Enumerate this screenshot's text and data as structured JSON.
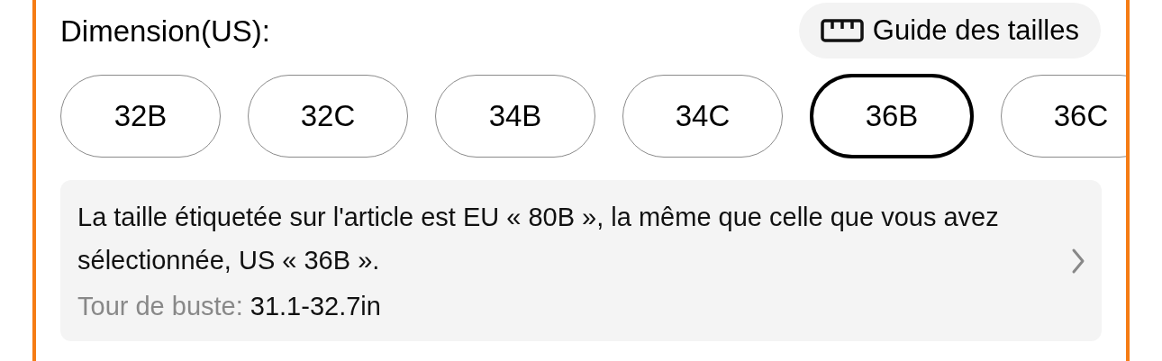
{
  "title": "Dimension(US):",
  "size_guide_button": {
    "label": "Guide des tailles"
  },
  "sizes": [
    {
      "label": "32B",
      "selected": false
    },
    {
      "label": "32C",
      "selected": false
    },
    {
      "label": "34B",
      "selected": false
    },
    {
      "label": "34C",
      "selected": false
    },
    {
      "label": "36B",
      "selected": true
    },
    {
      "label": "36C",
      "selected": false
    }
  ],
  "info": {
    "message": "La taille étiquetée sur l'article est EU « 80B », la même que celle que vous avez sélectionnée, US « 36B ».",
    "measure_label": "Tour de buste:",
    "measure_value": "31.1-32.7in"
  }
}
